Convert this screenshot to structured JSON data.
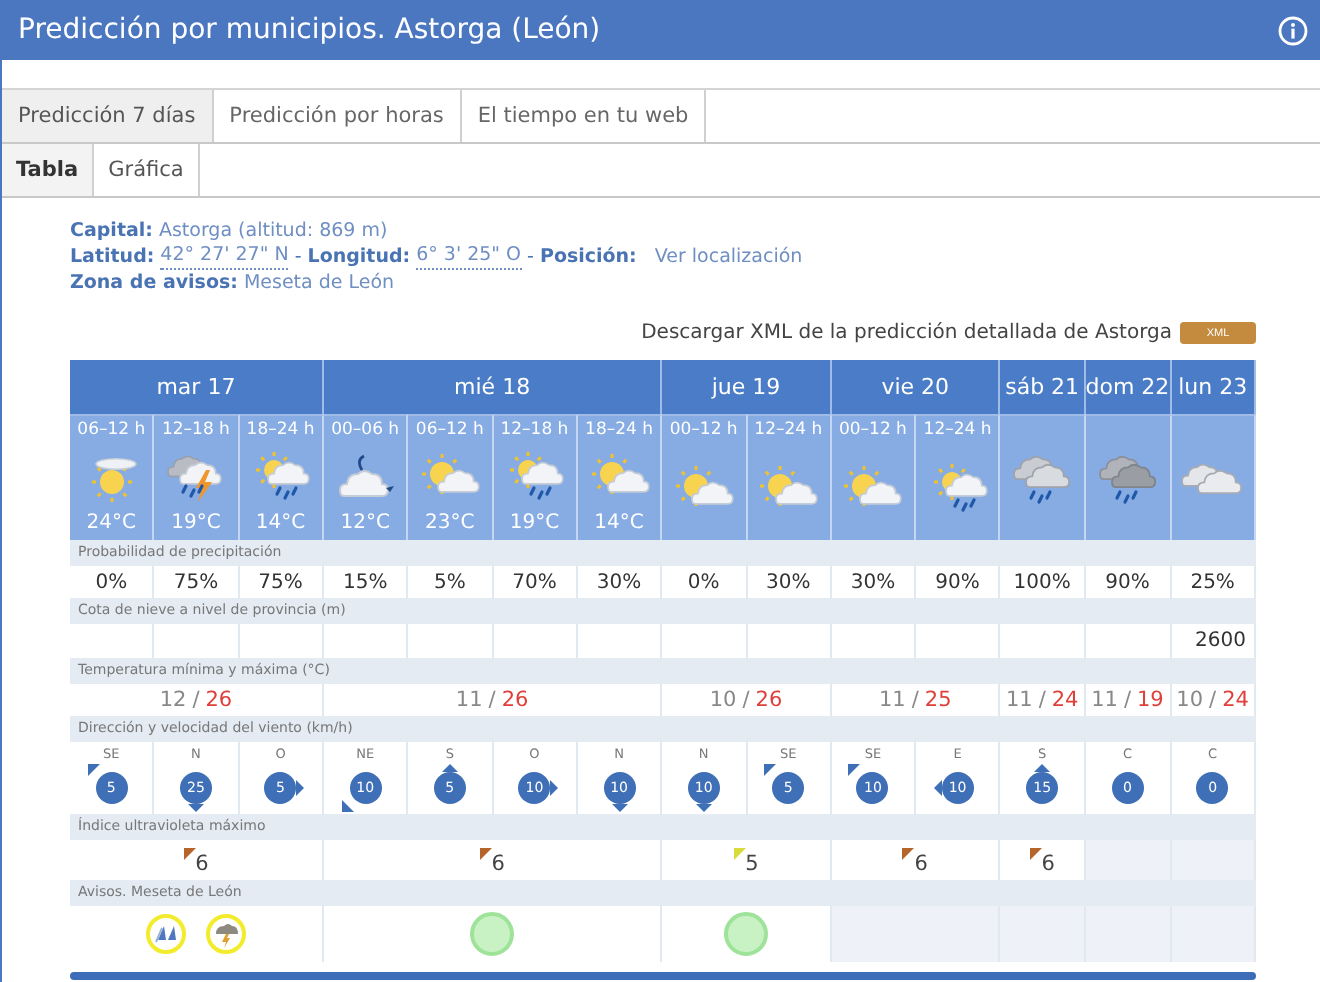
{
  "window": {
    "title": "Predicción por municipios. Astorga (León)"
  },
  "tabs": [
    {
      "label": "Predicción 7 días",
      "selected": true
    },
    {
      "label": "Predicción por horas",
      "selected": false
    },
    {
      "label": "El tiempo en tu web",
      "selected": false
    }
  ],
  "subtabs": [
    {
      "label": "Tabla",
      "selected": true
    },
    {
      "label": "Gráfica",
      "selected": false
    }
  ],
  "info": [
    [
      {
        "kind": "label",
        "text": "Capital:"
      },
      {
        "kind": "value",
        "text": "Astorga (altitud: 869 m)"
      }
    ],
    [
      {
        "kind": "label",
        "text": "Latitud:"
      },
      {
        "kind": "coord",
        "text": "42° 27' 27\" N"
      },
      {
        "kind": "sep",
        "text": "-"
      },
      {
        "kind": "label",
        "text": "Longitud:"
      },
      {
        "kind": "coord",
        "text": "6° 3' 25\" O"
      },
      {
        "kind": "sep",
        "text": "-"
      },
      {
        "kind": "label",
        "text": "Posición:"
      },
      {
        "kind": "link",
        "text": "Ver localización"
      }
    ],
    [
      {
        "kind": "label",
        "text": "Zona de avisos:"
      },
      {
        "kind": "value",
        "text": "Meseta de León"
      }
    ]
  ],
  "download": {
    "text": "Descargar XML de la predicción detallada de Astorga",
    "button": "XML"
  },
  "row_labels": {
    "precipitation": "Probabilidad de precipitación",
    "snow": "Cota de nieve a nivel de provincia (m)",
    "temperature": "Temperatura mínima y máxima (°C)",
    "wind": "Dirección y velocidad del viento (km/h)",
    "uv": "Índice ultravioleta máximo",
    "warnings": "Avisos. Meseta de León"
  },
  "days": [
    {
      "label": "mar 17",
      "separator": "/",
      "temp_min": "12",
      "temp_max": "26",
      "uv": {
        "value": "6",
        "color": "#b5652a"
      },
      "warnings": [
        {
          "kind": "rain",
          "color": "#f2ec2c"
        },
        {
          "kind": "storm",
          "color": "#f2ec2c"
        }
      ],
      "periods": [
        {
          "time": "06–12 h",
          "kind": "sun-haze",
          "temp": "24°C",
          "precipitation": "0%",
          "wind": {
            "dir": "SE",
            "speed": "5",
            "kind": "top-left"
          }
        },
        {
          "time": "12–18 h",
          "kind": "storm",
          "temp": "19°C",
          "precipitation": "75%",
          "wind": {
            "dir": "N",
            "speed": "25",
            "kind": "bottom"
          }
        },
        {
          "time": "18–24 h",
          "kind": "sun-cloud-rain",
          "temp": "14°C",
          "precipitation": "75%",
          "wind": {
            "dir": "O",
            "speed": "5",
            "kind": "right"
          }
        }
      ]
    },
    {
      "label": "mié 18",
      "separator": "/",
      "temp_min": "11",
      "temp_max": "26",
      "uv": {
        "value": "6",
        "color": "#b5652a"
      },
      "warnings": [
        {
          "kind": "plain",
          "color": "#9fe39a"
        }
      ],
      "periods": [
        {
          "time": "00–06 h",
          "kind": "moon-cloud",
          "temp": "12°C",
          "precipitation": "15%",
          "wind": {
            "dir": "NE",
            "speed": "10",
            "kind": "bottom-left"
          }
        },
        {
          "time": "06–12 h",
          "kind": "sun-cloud",
          "temp": "23°C",
          "precipitation": "5%",
          "wind": {
            "dir": "S",
            "speed": "5",
            "kind": "top"
          }
        },
        {
          "time": "12–18 h",
          "kind": "sun-cloud-rain",
          "temp": "19°C",
          "precipitation": "70%",
          "wind": {
            "dir": "O",
            "speed": "10",
            "kind": "right"
          }
        },
        {
          "time": "18–24 h",
          "kind": "sun-cloud",
          "temp": "14°C",
          "precipitation": "30%",
          "wind": {
            "dir": "N",
            "speed": "10",
            "kind": "bottom"
          }
        }
      ]
    },
    {
      "label": "jue 19",
      "separator": "/",
      "temp_min": "10",
      "temp_max": "26",
      "uv": {
        "value": "5",
        "color": "#d8dc3a"
      },
      "warnings": [
        {
          "kind": "plain",
          "color": "#9fe39a"
        }
      ],
      "periods": [
        {
          "time": "00–12 h",
          "kind": "sun-cloud",
          "precipitation": "0%",
          "wind": {
            "dir": "N",
            "speed": "10",
            "kind": "bottom"
          }
        },
        {
          "time": "12–24 h",
          "kind": "sun-cloud",
          "precipitation": "30%",
          "wind": {
            "dir": "SE",
            "speed": "5",
            "kind": "top-left"
          }
        }
      ]
    },
    {
      "label": "vie 20",
      "separator": "/",
      "temp_min": "11",
      "temp_max": "25",
      "uv": {
        "value": "6",
        "color": "#b5652a"
      },
      "periods": [
        {
          "time": "00–12 h",
          "kind": "sun-cloud",
          "precipitation": "30%",
          "wind": {
            "dir": "SE",
            "speed": "10",
            "kind": "top-left"
          }
        },
        {
          "time": "12–24 h",
          "kind": "sun-cloud-rain",
          "precipitation": "90%",
          "wind": {
            "dir": "E",
            "speed": "10",
            "kind": "left"
          }
        }
      ]
    },
    {
      "label": "sáb 21",
      "separator": "/",
      "temp_min": "11",
      "temp_max": "24",
      "uv": {
        "value": "6",
        "color": "#b5652a"
      },
      "periods": [
        {
          "kind": "rain-cloud",
          "precipitation": "100%",
          "wind": {
            "dir": "S",
            "speed": "15",
            "kind": "top"
          }
        }
      ]
    },
    {
      "label": "dom 22",
      "separator": "/",
      "temp_min": "11",
      "temp_max": "19",
      "periods": [
        {
          "kind": "dark-rain-cloud",
          "precipitation": "90%",
          "wind": {
            "dir": "C",
            "speed": "0",
            "kind": "none"
          }
        }
      ]
    },
    {
      "label": "lun 23",
      "separator": "/",
      "temp_min": "10",
      "temp_max": "24",
      "periods": [
        {
          "kind": "clouds",
          "precipitation": "25%",
          "snow": "2600",
          "wind": {
            "dir": "C",
            "speed": "0",
            "kind": "none"
          }
        }
      ]
    }
  ]
}
